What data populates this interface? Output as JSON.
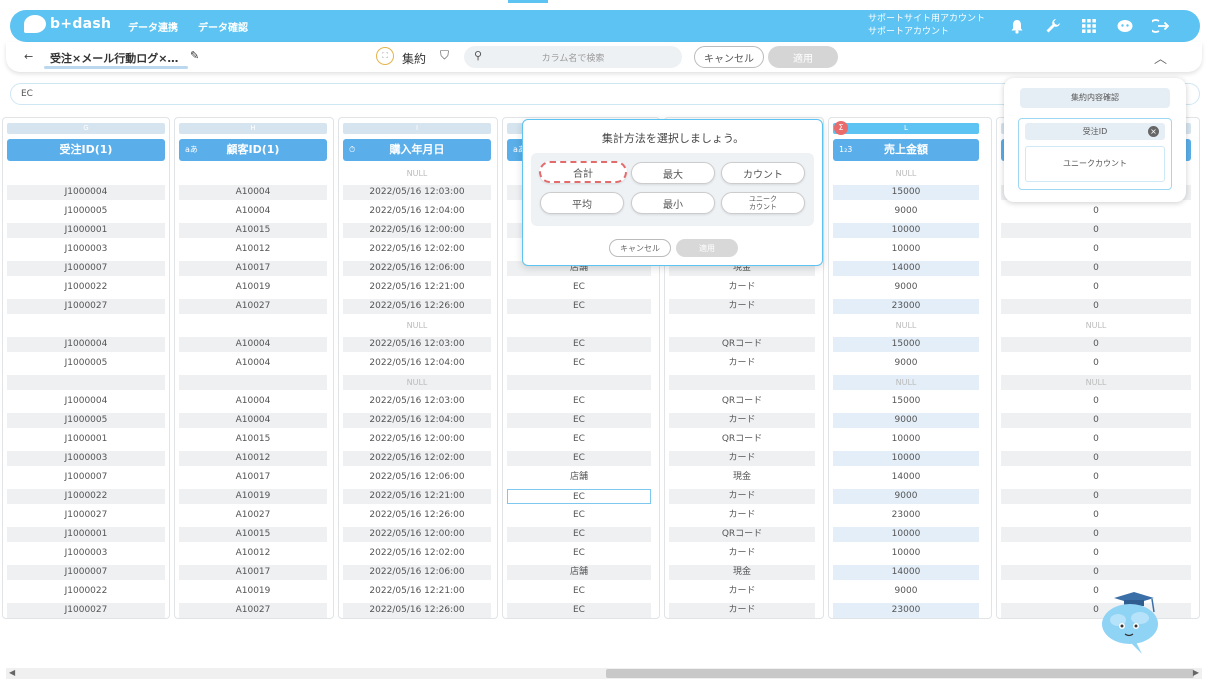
{
  "header": {
    "logo_text": "b+dash",
    "nav": [
      "データ連携",
      "データ確認"
    ],
    "account_line1": "サポートサイト用アカウント",
    "account_line2": "サポートアカウント",
    "icons": [
      "bell-icon",
      "wrench-icon",
      "apps-grid-icon",
      "chat-robot-icon",
      "logout-icon"
    ]
  },
  "toolbar": {
    "back_glyph": "←",
    "breadcrumb": "受注×メール行動ログ×…",
    "aggregate_label": "集約",
    "search_placeholder": "カラム名で検索",
    "cancel_label": "キャンセル",
    "apply_label": "適用"
  },
  "filter": {
    "value": "EC"
  },
  "columns": [
    {
      "letter": "G",
      "name": "受注ID(1)",
      "type_icon": ""
    },
    {
      "letter": "H",
      "name": "顧客ID(1)",
      "type_icon": "aあ"
    },
    {
      "letter": "I",
      "name": "購入年月日",
      "type_icon": "⏱"
    },
    {
      "letter": "J",
      "name": "",
      "type_icon": "aあ"
    },
    {
      "letter": "K",
      "name": "",
      "type_icon": ""
    },
    {
      "letter": "L",
      "name": "売上金額",
      "type_icon": "1₂3"
    },
    {
      "letter": "M",
      "name": "",
      "type_icon": ""
    }
  ],
  "rows": [
    [
      "",
      "",
      "NULL",
      "",
      "",
      "NULL",
      ""
    ],
    [
      "J1000004",
      "A10004",
      "2022/05/16 12:03:00",
      "",
      "",
      "15000",
      ""
    ],
    [
      "J1000005",
      "A10004",
      "2022/05/16 12:04:00",
      "",
      "",
      "9000",
      "0"
    ],
    [
      "J1000001",
      "A10015",
      "2022/05/16 12:00:00",
      "",
      "",
      "10000",
      "0"
    ],
    [
      "J1000003",
      "A10012",
      "2022/05/16 12:02:00",
      "",
      "",
      "10000",
      "0"
    ],
    [
      "J1000007",
      "A10017",
      "2022/05/16 12:06:00",
      "店舗",
      "現金",
      "14000",
      "0"
    ],
    [
      "J1000022",
      "A10019",
      "2022/05/16 12:21:00",
      "EC",
      "カード",
      "9000",
      "0"
    ],
    [
      "J1000027",
      "A10027",
      "2022/05/16 12:26:00",
      "EC",
      "カード",
      "23000",
      "0"
    ],
    [
      "",
      "",
      "NULL",
      "",
      "",
      "NULL",
      "NULL"
    ],
    [
      "J1000004",
      "A10004",
      "2022/05/16 12:03:00",
      "EC",
      "QRコード",
      "15000",
      "0"
    ],
    [
      "J1000005",
      "A10004",
      "2022/05/16 12:04:00",
      "EC",
      "カード",
      "9000",
      "0"
    ],
    [
      "",
      "",
      "NULL",
      "",
      "",
      "NULL",
      "NULL"
    ],
    [
      "J1000004",
      "A10004",
      "2022/05/16 12:03:00",
      "EC",
      "QRコード",
      "15000",
      "0"
    ],
    [
      "J1000005",
      "A10004",
      "2022/05/16 12:04:00",
      "EC",
      "カード",
      "9000",
      "0"
    ],
    [
      "J1000001",
      "A10015",
      "2022/05/16 12:00:00",
      "EC",
      "QRコード",
      "10000",
      "0"
    ],
    [
      "J1000003",
      "A10012",
      "2022/05/16 12:02:00",
      "EC",
      "カード",
      "10000",
      "0"
    ],
    [
      "J1000007",
      "A10017",
      "2022/05/16 12:06:00",
      "店舗",
      "現金",
      "14000",
      "0"
    ],
    [
      "J1000022",
      "A10019",
      "2022/05/16 12:21:00",
      "EC",
      "カード",
      "9000",
      "0"
    ],
    [
      "J1000027",
      "A10027",
      "2022/05/16 12:26:00",
      "EC",
      "カード",
      "23000",
      "0"
    ],
    [
      "J1000001",
      "A10015",
      "2022/05/16 12:00:00",
      "EC",
      "QRコード",
      "10000",
      "0"
    ],
    [
      "J1000003",
      "A10012",
      "2022/05/16 12:02:00",
      "EC",
      "カード",
      "10000",
      "0"
    ],
    [
      "J1000007",
      "A10017",
      "2022/05/16 12:06:00",
      "店舗",
      "現金",
      "14000",
      "0"
    ],
    [
      "J1000022",
      "A10019",
      "2022/05/16 12:21:00",
      "EC",
      "カード",
      "9000",
      "0"
    ],
    [
      "J1000027",
      "A10027",
      "2022/05/16 12:26:00",
      "EC",
      "カード",
      "23000",
      "0"
    ]
  ],
  "popup": {
    "title": "集計方法を選択しましょう。",
    "options": [
      "合計",
      "最大",
      "カウント",
      "平均",
      "最小",
      "ユニーク\nカウント"
    ],
    "selected": "合計",
    "cancel_label": "キャンセル",
    "apply_label": "適用",
    "sigma_badge": "Σ"
  },
  "confirm_panel": {
    "title": "集約内容確認",
    "column_tag": "受注ID",
    "remove_glyph": "×",
    "mode": "ユニークカウント"
  },
  "colors": {
    "accent": "#5cc3f2",
    "header_blue": "#5aaee9",
    "highlight_red": "#e46b6b"
  }
}
